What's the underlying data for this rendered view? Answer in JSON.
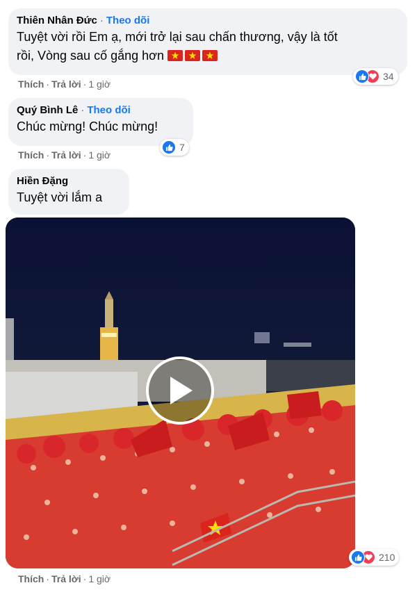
{
  "comments": [
    {
      "author": "Thiên Nhân Đức",
      "separator": "·",
      "follow_label": "Theo dõi",
      "text_line1": "Tuyệt vời rồi Em ạ, mới trở lại sau chấn thương, vậy là tốt",
      "text_line2": "rồi, Vòng sau cố gắng hơn",
      "emoji": [
        "vietnam-flag",
        "vietnam-flag",
        "vietnam-flag"
      ],
      "like_label": "Thích",
      "reply_label": "Trả lời",
      "time": "1 giờ",
      "reaction_count": "34",
      "reactions": [
        "like",
        "love"
      ]
    },
    {
      "author": "Quý Bình Lê",
      "separator": "·",
      "follow_label": "Theo dõi",
      "text_line1": "Chúc mừng! Chúc mừng!",
      "like_label": "Thích",
      "reply_label": "Trả lời",
      "time": "1 giờ",
      "reaction_count": "7",
      "reactions": [
        "like"
      ]
    },
    {
      "author": "Hiền Đặng",
      "text_line1": "Tuyệt vời lắm a",
      "video": {
        "description_icon": "play-icon",
        "reaction_count": "210",
        "reactions": [
          "like",
          "love"
        ]
      },
      "like_label": "Thích",
      "reply_label": "Trả lời",
      "time": "1 giờ"
    }
  ],
  "colors": {
    "bubble": "#f0f2f5",
    "link_blue": "#1877f2",
    "love_red": "#f33e58",
    "meta_gray": "#65676b",
    "flag_red": "#da251d",
    "flag_star": "#ffde00"
  }
}
